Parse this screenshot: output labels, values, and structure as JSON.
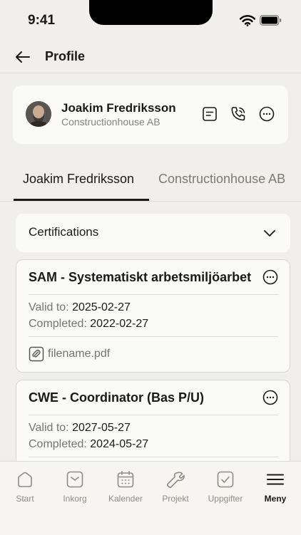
{
  "status_bar": {
    "time": "9:41"
  },
  "header": {
    "title": "Profile"
  },
  "profile": {
    "name": "Joakim Fredriksson",
    "company": "Constructionhouse AB"
  },
  "tabs": [
    {
      "label": "Joakim Fredriksson",
      "active": true
    },
    {
      "label": "Constructionhouse AB",
      "active": false
    }
  ],
  "section": {
    "title": "Certifications"
  },
  "certifications": [
    {
      "title": "SAM - Systematiskt arbetsmiljöarbet",
      "valid_label": "Valid to:",
      "valid_value": "2025-02-27",
      "completed_label": "Completed:",
      "completed_value": "2022-02-27",
      "file": "filename.pdf"
    },
    {
      "title": "CWE - Coordinator (Bas P/U)",
      "valid_label": "Valid to:",
      "valid_value": "2027-05-27",
      "completed_label": "Completed:",
      "completed_value": "2024-05-27"
    }
  ],
  "tab_bar": [
    {
      "label": "Start",
      "icon": "home-icon",
      "active": false
    },
    {
      "label": "Inkorg",
      "icon": "inbox-icon",
      "active": false
    },
    {
      "label": "Kalender",
      "icon": "calendar-icon",
      "active": false
    },
    {
      "label": "Projekt",
      "icon": "wrench-icon",
      "active": false
    },
    {
      "label": "Uppgifter",
      "icon": "checkbox-icon",
      "active": false
    },
    {
      "label": "Meny",
      "icon": "menu-icon",
      "active": true
    }
  ],
  "colors": {
    "background": "#f0efeb",
    "card": "#fafaf8",
    "text": "#1a1a1a",
    "muted": "#76746f",
    "border": "#dedcd7"
  }
}
